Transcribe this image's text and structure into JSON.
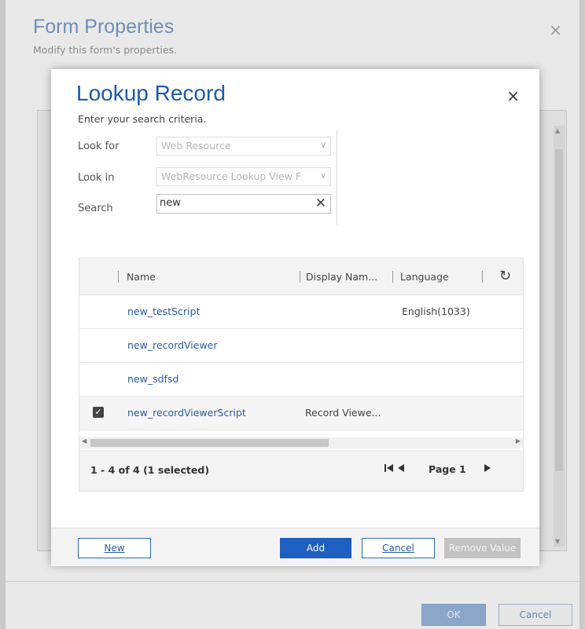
{
  "outer": {
    "title": "Form Properties",
    "subtitle": "Modify this form's properties.",
    "close_icon": "×",
    "ok_label": "OK",
    "cancel_label": "Cancel"
  },
  "dialog": {
    "title": "Lookup Record",
    "subtitle": "Enter your search criteria.",
    "close_icon": "×"
  },
  "criteria": {
    "look_for_label": "Look for",
    "look_for_value": "Web Resource",
    "look_in_label": "Look in",
    "look_in_value": "WebResource Lookup View F",
    "search_label": "Search",
    "search_value": "new",
    "clear_icon": "✕"
  },
  "grid": {
    "columns": [
      "Name",
      "Display Nam...",
      "Language"
    ],
    "refresh_icon": "↻",
    "rows": [
      {
        "name": "new_testScript",
        "display_name": "",
        "language": "English(1033)",
        "selected": false
      },
      {
        "name": "new_recordViewer",
        "display_name": "",
        "language": "",
        "selected": false
      },
      {
        "name": "new_sdfsd",
        "display_name": "",
        "language": "",
        "selected": false
      },
      {
        "name": "new_recordViewerScript",
        "display_name": "Record Viewe...",
        "language": "",
        "selected": true
      }
    ],
    "checkmark": "✓"
  },
  "pager": {
    "count": "1 - 4 of 4 (1 selected)",
    "page_label": "Page 1",
    "first_icon": "⏮",
    "prev_icon": "◀",
    "next_icon": "▶"
  },
  "buttons": {
    "new": "New",
    "add": "Add",
    "cancel": "Cancel",
    "remove": "Remove Value"
  },
  "colors": {
    "title_blue": "#1f5aa8",
    "link_blue": "#2b5ca8",
    "primary_button": "#1e5fbf",
    "disabled_button": "#c2c2c2"
  }
}
